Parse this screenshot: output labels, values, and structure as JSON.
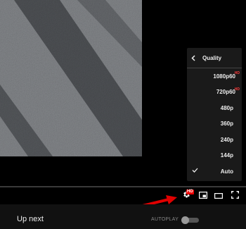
{
  "player": {
    "controls": {
      "settings": {
        "icon": "gear-icon",
        "badge": "HD"
      },
      "miniplayer": {
        "icon": "miniplayer-icon"
      },
      "theater": {
        "icon": "theater-mode-icon"
      },
      "fullscreen": {
        "icon": "fullscreen-icon"
      }
    },
    "quality_menu": {
      "title": "Quality",
      "back_icon": "chevron-left-icon",
      "options": [
        {
          "label": "1080p60",
          "hd_badge": "HD"
        },
        {
          "label": "720p60",
          "hd_badge": "HD"
        },
        {
          "label": "480p"
        },
        {
          "label": "360p"
        },
        {
          "label": "240p"
        },
        {
          "label": "144p"
        },
        {
          "label": "Auto",
          "selected": true
        }
      ]
    },
    "annotation_arrow": {
      "color": "#e00000",
      "target": "settings"
    }
  },
  "bottom": {
    "up_next": "Up next",
    "autoplay_label": "AUTOPLAY",
    "autoplay_on": false
  },
  "colors": {
    "menu_bg": "#1c1c1c",
    "hd_red": "#e00000",
    "text": "#eeeeee"
  }
}
